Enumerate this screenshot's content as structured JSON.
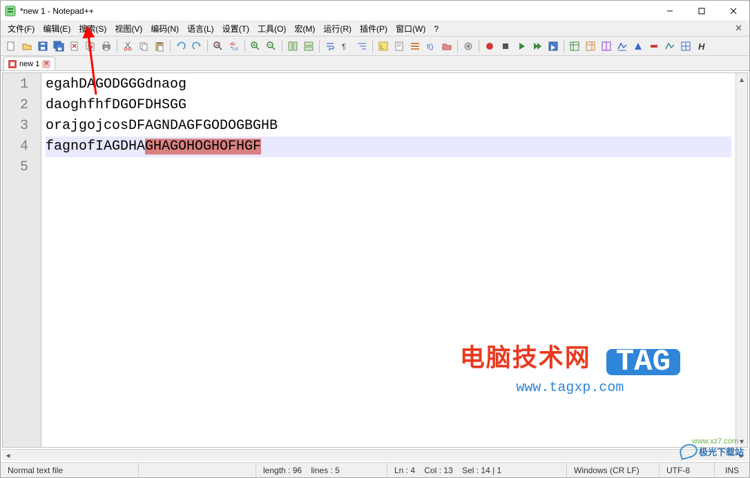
{
  "window": {
    "title": "*new 1 - Notepad++",
    "controls": {
      "min": "minimize",
      "max": "maximize",
      "close": "close"
    }
  },
  "menu": {
    "items": [
      "文件(F)",
      "编辑(E)",
      "搜索(S)",
      "视图(V)",
      "编码(N)",
      "语言(L)",
      "设置(T)",
      "工具(O)",
      "宏(M)",
      "运行(R)",
      "插件(P)",
      "窗口(W)",
      "?"
    ]
  },
  "toolbar_icons": [
    "new-file-icon",
    "open-file-icon",
    "save-icon",
    "save-all-icon",
    "close-file-icon",
    "close-all-icon",
    "print-icon",
    "sep",
    "cut-icon",
    "copy-icon",
    "paste-icon",
    "sep",
    "undo-icon",
    "redo-icon",
    "sep",
    "find-icon",
    "replace-icon",
    "sep",
    "zoom-in-icon",
    "zoom-out-icon",
    "sep",
    "sync-v-icon",
    "sync-h-icon",
    "sep",
    "word-wrap-icon",
    "all-chars-icon",
    "indent-guide-icon",
    "sep",
    "lang-udl-icon",
    "doc-map-icon",
    "doc-list-icon",
    "func-list-icon",
    "folder-icon",
    "sep",
    "monitor-icon",
    "sep",
    "record-macro-icon",
    "stop-macro-icon",
    "play-macro-icon",
    "play-multi-icon",
    "save-macro-icon",
    "sep",
    "t1-icon",
    "t2-icon",
    "t3-icon",
    "t4-icon",
    "t5-icon",
    "t6-icon",
    "t7-icon",
    "t8-icon",
    "bold-h-icon"
  ],
  "tabs": [
    {
      "label": "new 1",
      "dirty": true
    }
  ],
  "editor": {
    "lines": [
      {
        "n": 1,
        "text": "egahDAGODGGGdnaog"
      },
      {
        "n": 2,
        "text": "daoghfhfDGOFDHSGG"
      },
      {
        "n": 3,
        "text": "orajgojcosDFAGNDAGFGODOGBGHB"
      },
      {
        "n": 4,
        "text_pre": "fagnofIAGDHA",
        "text_sel": "GHAGOHOGHOFHGF",
        "current": true
      },
      {
        "n": 5,
        "text": ""
      }
    ]
  },
  "status": {
    "filetype": "Normal text file",
    "length": "length : 96",
    "lines": "lines : 5",
    "ln": "Ln : 4",
    "col": "Col : 13",
    "sel": "Sel : 14 | 1",
    "eol": "Windows (CR LF)",
    "encoding": "UTF-8",
    "mode": "INS"
  },
  "watermark1": {
    "text": "电脑技术网",
    "tag": "TAG",
    "url": "www.tagxp.com"
  },
  "watermark2": {
    "cn": "极光下载站",
    "en": "www.xz7.com"
  },
  "colors": {
    "selection_bg": "#d98080",
    "current_line_bg": "#e8e8ff",
    "gutter_bg": "#e8e8e8"
  }
}
